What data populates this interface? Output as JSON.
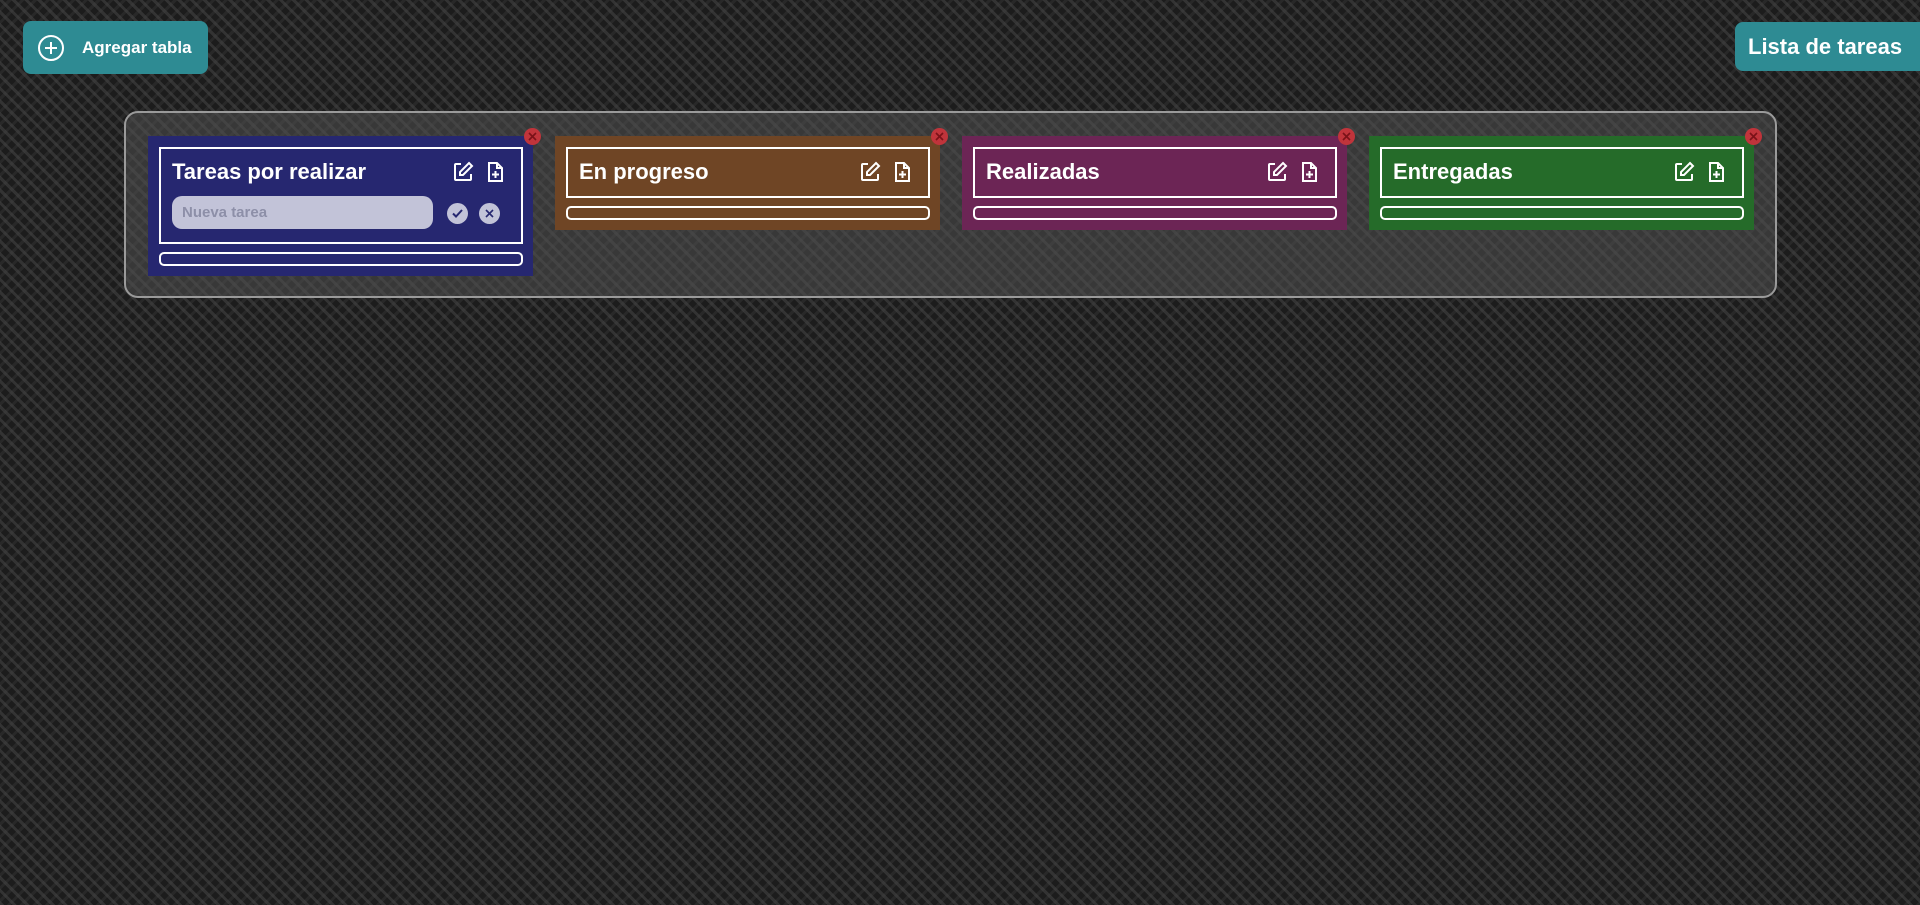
{
  "toolbar": {
    "add_table_label": "Agregar tabla",
    "app_title": "Lista de tareas"
  },
  "colors": {
    "accent": "#2e8b93",
    "close": "#c0343b"
  },
  "columns": [
    {
      "title": "Tareas por realizar",
      "color": "#262770",
      "new_task_placeholder": "Nueva tarea",
      "icons": [
        "edit-icon",
        "add-file-icon",
        "close-icon"
      ]
    },
    {
      "title": "En progreso",
      "color": "#6f4525",
      "icons": [
        "edit-icon",
        "add-file-icon",
        "close-icon"
      ]
    },
    {
      "title": "Realizadas",
      "color": "#6c2555",
      "icons": [
        "edit-icon",
        "add-file-icon",
        "close-icon"
      ]
    },
    {
      "title": "Entregadas",
      "color": "#256b29",
      "icons": [
        "edit-icon",
        "add-file-icon",
        "close-icon"
      ]
    }
  ]
}
